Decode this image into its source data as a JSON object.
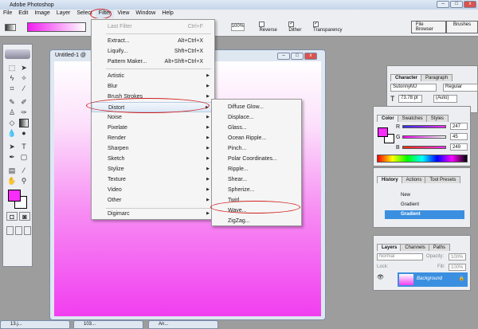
{
  "app": {
    "title": "Adobe Photoshop"
  },
  "menubar": [
    "File",
    "Edit",
    "Image",
    "Layer",
    "Select",
    "Filter",
    "View",
    "Window",
    "Help"
  ],
  "options": {
    "opacity": "100%",
    "reverse": "Reverse",
    "dither": "Dither",
    "transparency": "Transparency",
    "file_browser": "File Browser",
    "brushes": "Brushes"
  },
  "document": {
    "title": "Untitled-1 @"
  },
  "filter_menu": {
    "last_filter": {
      "label": "Last Filter",
      "shortcut": "Ctrl+F"
    },
    "top": [
      {
        "label": "Extract...",
        "shortcut": "Alt+Ctrl+X"
      },
      {
        "label": "Liquify...",
        "shortcut": "Shft+Ctrl+X"
      },
      {
        "label": "Pattern Maker...",
        "shortcut": "Alt+Shft+Ctrl+X"
      }
    ],
    "groups": [
      "Artistic",
      "Blur",
      "Brush Strokes",
      "Distort",
      "Noise",
      "Pixelate",
      "Render",
      "Sharpen",
      "Sketch",
      "Stylize",
      "Texture",
      "Video",
      "Other"
    ],
    "bottom": "Digimarc"
  },
  "distort_submenu": [
    "Diffuse Glow...",
    "Displace...",
    "Glass...",
    "Ocean Ripple...",
    "Pinch...",
    "Polar Coordinates...",
    "Ripple...",
    "Shear...",
    "Spherize...",
    "Twirl...",
    "Wave...",
    "ZigZag..."
  ],
  "character": {
    "tabs": [
      "Character",
      "Paragraph"
    ],
    "font": "SutonnyMJ",
    "style": "Regular",
    "size": "73.78 pt",
    "leading": "(Auto)"
  },
  "color": {
    "tabs": [
      "Color",
      "Swatches",
      "Styles"
    ],
    "channels": [
      {
        "label": "R",
        "value": "247"
      },
      {
        "label": "G",
        "value": "45"
      },
      {
        "label": "B",
        "value": "249"
      }
    ],
    "foreground": "#f72df9"
  },
  "history": {
    "tabs": [
      "History",
      "Actions",
      "Tool Presets"
    ],
    "items": [
      "New",
      "Gradient",
      "Gradient"
    ]
  },
  "layers": {
    "tabs": [
      "Layers",
      "Channels",
      "Paths"
    ],
    "blend": "Normal",
    "opacity_label": "Opacity:",
    "opacity": "100%",
    "lock_label": "Lock:",
    "fill_label": "Fill:",
    "fill": "100%",
    "layer": "Background"
  },
  "minimized": [
    "13.j...",
    "103...",
    "An..."
  ]
}
